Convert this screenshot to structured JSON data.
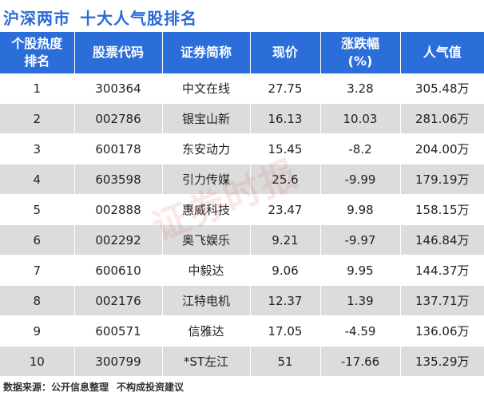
{
  "title": {
    "main": "沪深两市",
    "sub": "十大人气股排名"
  },
  "headers": [
    "个股热度\n排名",
    "股票代码",
    "证券简称",
    "现价",
    "涨跌幅\n(%)",
    "人气值"
  ],
  "rows": [
    [
      "1",
      "300364",
      "中文在线",
      "27.75",
      "3.28",
      "305.48万"
    ],
    [
      "2",
      "002786",
      "银宝山新",
      "16.13",
      "10.03",
      "281.06万"
    ],
    [
      "3",
      "600178",
      "东安动力",
      "15.45",
      "-8.2",
      "204.00万"
    ],
    [
      "4",
      "603598",
      "引力传媒",
      "25.6",
      "-9.99",
      "179.19万"
    ],
    [
      "5",
      "002888",
      "惠威科技",
      "23.47",
      "9.98",
      "158.15万"
    ],
    [
      "6",
      "002292",
      "奥飞娱乐",
      "9.21",
      "-9.97",
      "146.84万"
    ],
    [
      "7",
      "600610",
      "中毅达",
      "9.06",
      "9.95",
      "144.37万"
    ],
    [
      "8",
      "002176",
      "江特电机",
      "12.37",
      "1.39",
      "137.71万"
    ],
    [
      "9",
      "600571",
      "信雅达",
      "17.05",
      "-4.59",
      "136.06万"
    ],
    [
      "10",
      "300799",
      "*ST左江",
      "51",
      "-17.66",
      "135.29万"
    ]
  ],
  "footer": {
    "source": "数据来源：公开信息整理",
    "disclaimer": "不构成投资建议"
  },
  "watermark": "证券时报",
  "colors": {
    "title": "#2a6bd6",
    "header_bg": "#2b6ed9",
    "row_alt": "#dcdcdc"
  }
}
